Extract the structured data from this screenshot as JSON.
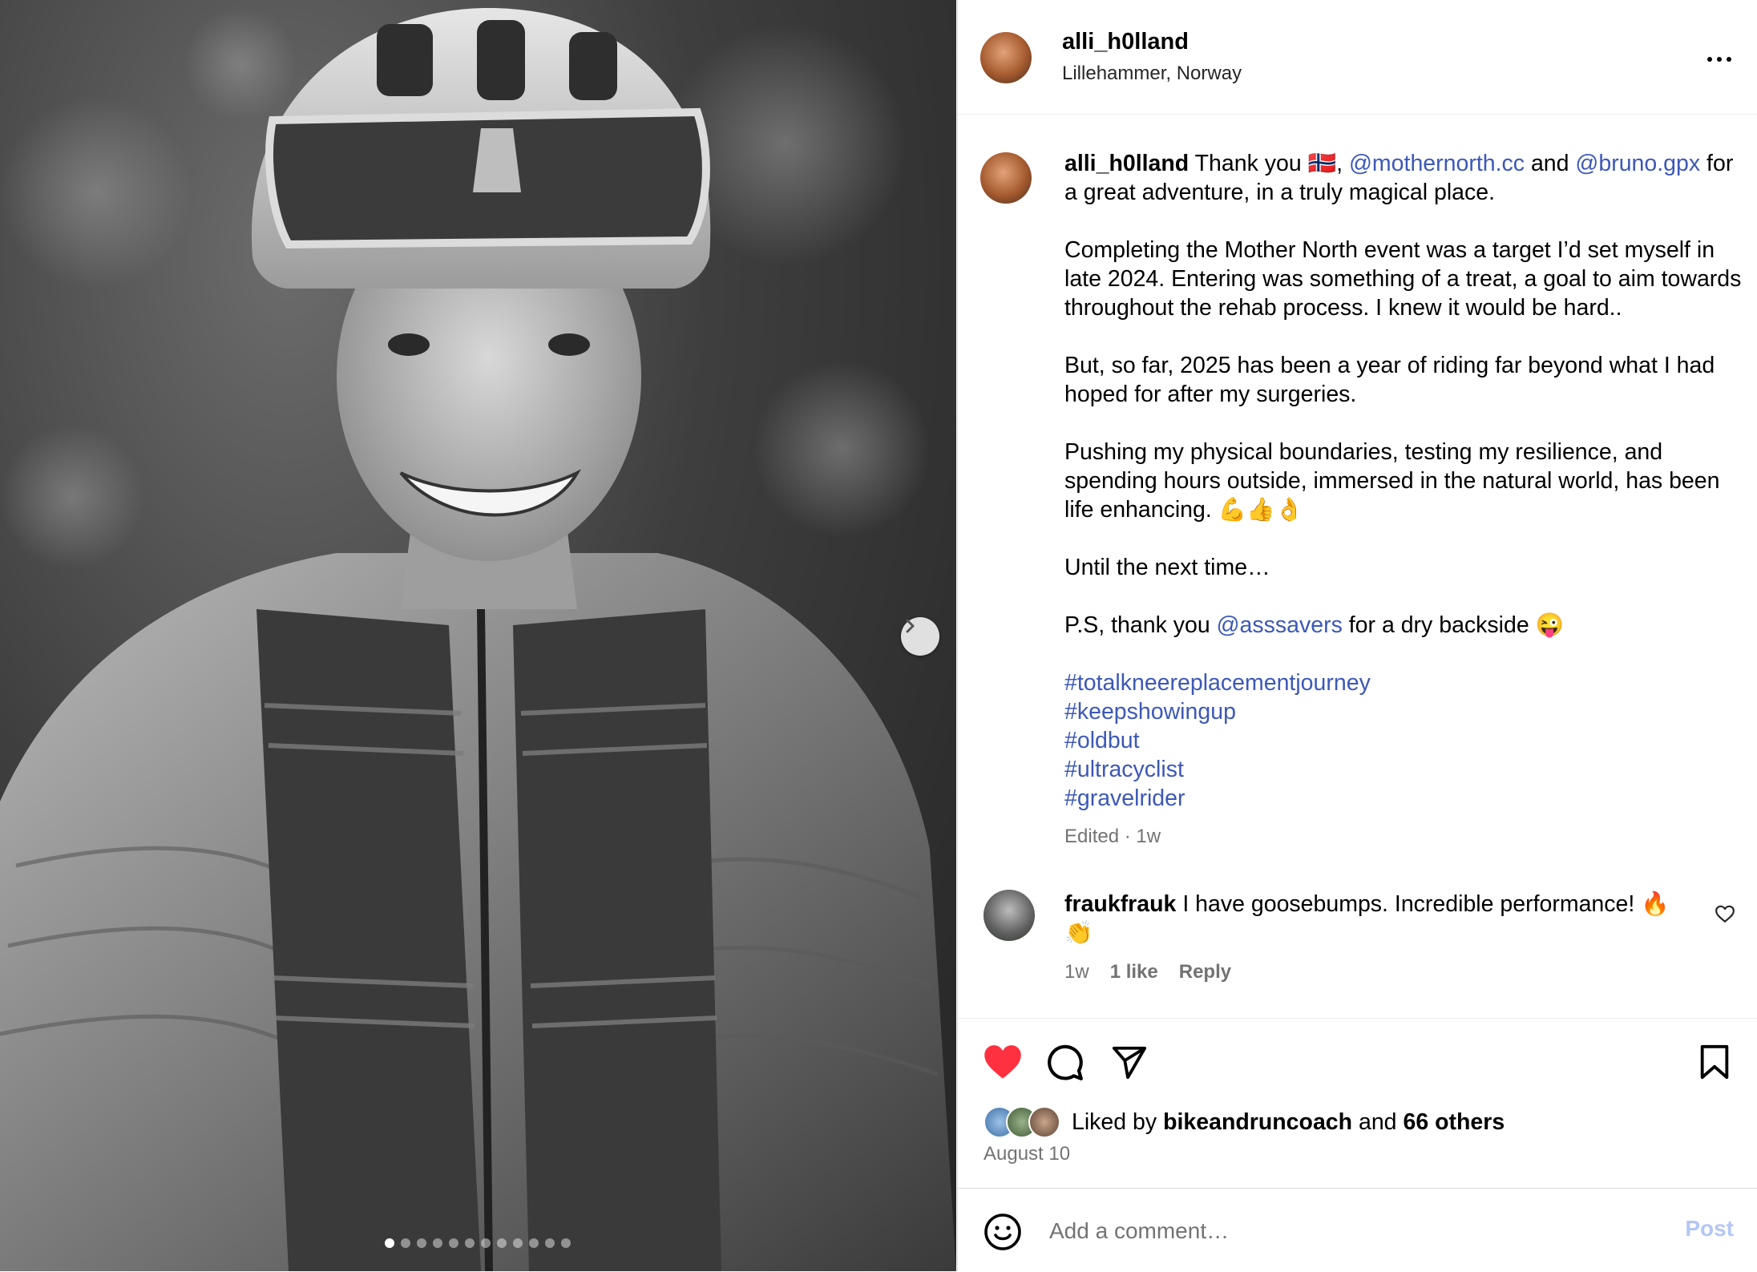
{
  "post": {
    "author": "alli_h0lland",
    "location": "Lillehammer, Norway"
  },
  "caption": {
    "author": "alli_h0lland",
    "thank_you": "Thank you",
    "flag_emoji": "🇳🇴",
    "comma": ",",
    "mention_1": "@mothernorth.cc",
    "and": "and",
    "mention_2": "@bruno.gpx",
    "line_1_end": "for a great adventure, in a truly magical place.",
    "para_2": "Completing the Mother North event was a target I’d set myself in late 2024. Entering was something of a treat, a goal to aim towards throughout the rehab process. I knew it would be hard..",
    "para_3": "But, so far, 2025 has been a year of riding far beyond what I had hoped for after my surgeries.",
    "para_4": "Pushing my physical boundaries, testing my resilience, and spending hours outside, immersed in the natural world, has been life enhancing.",
    "para_4_emoji": "💪👍👌",
    "para_5": "Until the next time…",
    "ps_start": "P.S, thank you",
    "ps_mention": "@asssavers",
    "ps_end": "for a dry backside",
    "ps_emoji": "😜",
    "hashtags": [
      "#totalkneereplacementjourney",
      "#keepshowingup",
      "#oldbut",
      "#ultracyclist",
      "#gravelrider"
    ],
    "edited": "Edited",
    "separator": "·",
    "time": "1w"
  },
  "comment": {
    "author": "fraukfrauk",
    "text": "I have goosebumps. Incredible performance!",
    "emoji": "🔥 👏",
    "time": "1w",
    "likes": "1 like",
    "reply": "Reply"
  },
  "likes": {
    "prefix": "Liked by",
    "user": "bikeandruncoach",
    "and": "and",
    "others": "66 others"
  },
  "date": "August 10",
  "add_comment": {
    "placeholder": "Add a comment…",
    "post_label": "Post"
  },
  "carousel": {
    "total_slides": 12,
    "active_slide": 1
  },
  "colors": {
    "link": "#3c58b8",
    "like_red": "#ff3040",
    "muted": "#737373",
    "post_disabled": "#b3c6f5"
  }
}
